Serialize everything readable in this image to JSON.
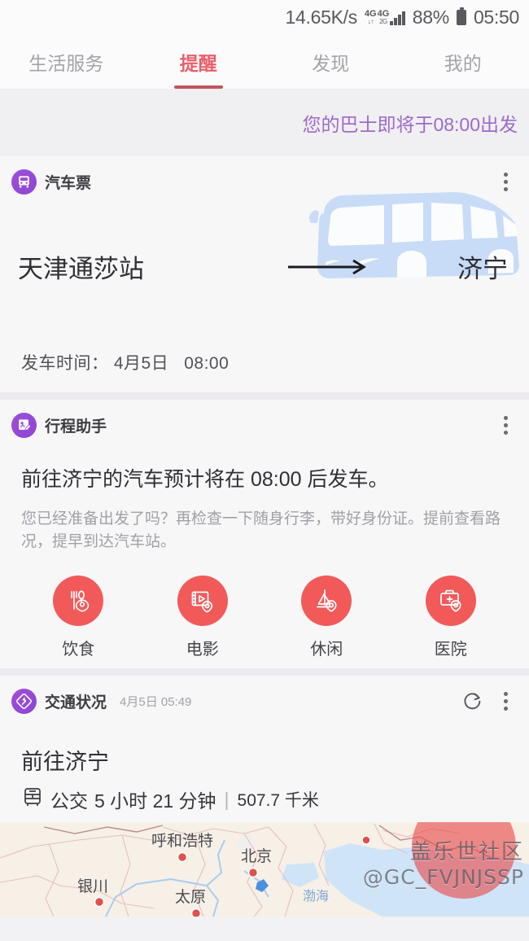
{
  "status_bar": {
    "network_speed": "14.65K/s",
    "signal_primary": "4G",
    "signal_primary_sub": "↓↑",
    "signal_secondary": "4G",
    "signal_secondary_sub": "2G",
    "battery": "88%",
    "clock": "05:50"
  },
  "tabs": [
    {
      "label": "生活服务",
      "active": false
    },
    {
      "label": "提醒",
      "active": true
    },
    {
      "label": "发现",
      "active": false
    },
    {
      "label": "我的",
      "active": false
    }
  ],
  "banner": {
    "text": "您的巴士即将于08:00出发",
    "color": "#9c6bc9"
  },
  "ticket_card": {
    "app_name": "汽车票",
    "app_icon": "bus-icon",
    "menu_icon": "more-vertical-icon",
    "from": "天津通莎站",
    "to": "济宁",
    "arrow_icon": "arrow-right-icon",
    "illustration": "bus-illustration",
    "departure_label": "发车时间：",
    "departure_date": "4月5日",
    "departure_time": "08:00"
  },
  "assistant_card": {
    "app_name": "行程助手",
    "app_icon": "trip-assistant-icon",
    "menu_icon": "more-vertical-icon",
    "title": "前往济宁的汽车预计将在 08:00 后发车。",
    "body": "您已经准备出发了吗？再检查一下随身行李，带好身份证。提前查看路况，提早到达汽车站。",
    "shortcuts": [
      {
        "label": "饮食",
        "icon": "restaurant-pin-icon"
      },
      {
        "label": "电影",
        "icon": "movie-pin-icon"
      },
      {
        "label": "休闲",
        "icon": "leisure-sailboat-pin-icon"
      },
      {
        "label": "医院",
        "icon": "hospital-pin-icon"
      }
    ],
    "accent": "#f25a5a"
  },
  "traffic_card": {
    "app_name": "交通状况",
    "app_icon": "road-sign-icon",
    "timestamp": "4月5日 05:49",
    "refresh_icon": "refresh-icon",
    "menu_icon": "more-vertical-icon",
    "destination": "前往济宁",
    "mode_icon": "bus-side-icon",
    "mode": "公交",
    "duration": "5 小时 21 分钟",
    "separator": "|",
    "distance": "507.7 千米"
  },
  "map": {
    "cities": [
      "呼和浩特",
      "北京",
      "银川",
      "太原"
    ],
    "sea_label": "渤海",
    "watermark_cn": "盖乐世社区",
    "watermark_id": "@GC_FVJNJSSP"
  }
}
